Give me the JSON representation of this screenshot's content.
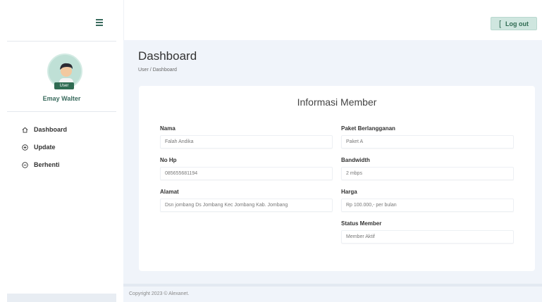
{
  "sidebar": {
    "user_badge": "User",
    "user_name": "Emay Walter",
    "items": [
      {
        "label": "Dashboard",
        "icon": "home-icon"
      },
      {
        "label": "Update",
        "icon": "plus-circle-icon"
      },
      {
        "label": "Berhenti",
        "icon": "minus-circle-icon"
      }
    ]
  },
  "topbar": {
    "logout_label": "Log out"
  },
  "page": {
    "title": "Dashboard",
    "breadcrumb": "User / Dashboard"
  },
  "card": {
    "title": "Informasi Member",
    "fields": {
      "nama": {
        "label": "Nama",
        "value": "Falah Andika"
      },
      "no_hp": {
        "label": "No Hp",
        "value": "085655681194"
      },
      "alamat": {
        "label": "Alamat",
        "value": "Dsn jombang Ds Jombang Kec Jombang Kab. Jombang"
      },
      "paket": {
        "label": "Paket Berlangganan",
        "value": "Paket A"
      },
      "bandwidth": {
        "label": "Bandwidth",
        "value": "2 mbps"
      },
      "harga": {
        "label": "Harga",
        "value": "Rp 100.000,- per bulan"
      },
      "status": {
        "label": "Status Member",
        "value": "Member Aktif"
      }
    }
  },
  "footer": {
    "text": "Copyright 2023 © Alexanet."
  },
  "colors": {
    "accent": "#3a6b5e",
    "button_bg": "#cfe6df",
    "main_bg": "#f0f4fa"
  }
}
